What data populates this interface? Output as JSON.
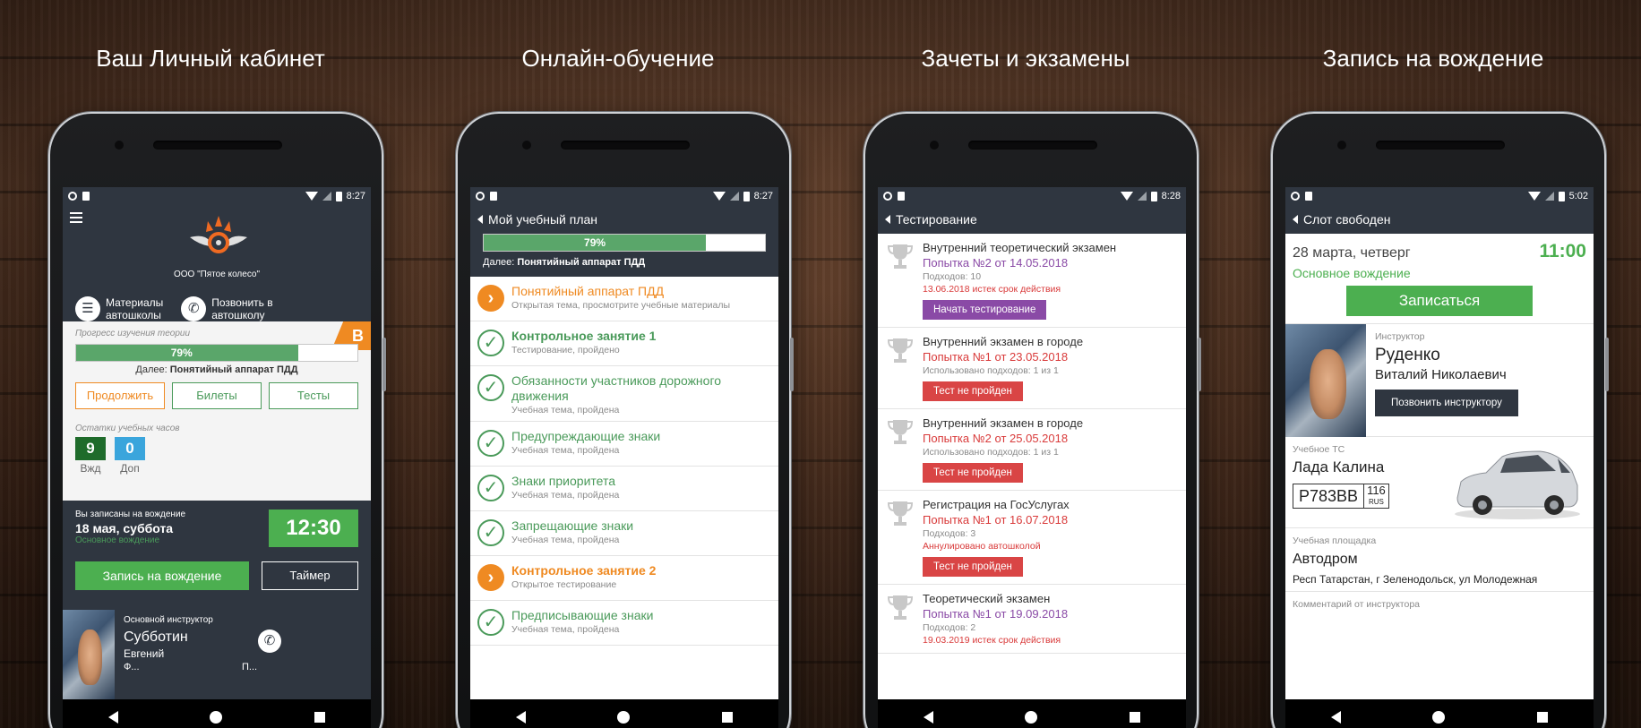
{
  "panels": [
    {
      "title": "Ваш Личный кабинет",
      "status_time": "8:27",
      "org_name": "ООО \"Пятое колесо\"",
      "actions": [
        {
          "label_line1": "Материалы",
          "label_line2": "автошколы",
          "icon": "book-icon"
        },
        {
          "label_line1": "Позвонить в",
          "label_line2": "автошколу",
          "icon": "phone-icon"
        }
      ],
      "category_badge": "B",
      "progress_label": "Прогресс изучения теории",
      "progress_percent": 79,
      "progress_text": "79%",
      "next_prefix": "Далее:",
      "next_topic": "Понятийный аппарат ПДД",
      "buttons": [
        "Продолжить",
        "Билеты",
        "Тесты"
      ],
      "hours_label": "Остатки учебных часов",
      "hours": [
        {
          "value": "9",
          "label": "Вжд",
          "color": "#1f6b2b"
        },
        {
          "value": "0",
          "label": "Доп",
          "color": "#3aa5dc"
        }
      ],
      "drive": {
        "status": "Вы записаны на вождение",
        "date": "18 мая, суббота",
        "type": "Основное вождение",
        "time": "12:30",
        "book_button": "Запись на вождение",
        "timer_button": "Таймер"
      },
      "instructor": {
        "role": "Основной инструктор",
        "surname": "Субботин",
        "name": "Евгений",
        "cut_left": "Ф...",
        "cut_right": "П..."
      }
    },
    {
      "title": "Онлайн-обучение",
      "status_time": "8:27",
      "header": "Мой учебный план",
      "progress_percent": 79,
      "progress_text": "79%",
      "next_prefix": "Далее:",
      "next_topic": "Понятийный аппарат ПДД",
      "items": [
        {
          "title": "Понятийный аппарат ПДД",
          "sub": "Открытая тема, просмотрите учебные материалы",
          "state": "open"
        },
        {
          "title": "Контрольное занятие 1",
          "sub": "Тестирование, пройдено",
          "state": "done-bold"
        },
        {
          "title": "Обязанности участников дорожного движения",
          "sub": "Учебная тема, пройдена",
          "state": "done"
        },
        {
          "title": "Предупреждающие знаки",
          "sub": "Учебная тема, пройдена",
          "state": "done"
        },
        {
          "title": "Знаки приоритета",
          "sub": "Учебная тема, пройдена",
          "state": "done"
        },
        {
          "title": "Запрещающие знаки",
          "sub": "Учебная тема, пройдена",
          "state": "done"
        },
        {
          "title": "Контрольное занятие 2",
          "sub": "Открытое тестирование",
          "state": "open-bold"
        },
        {
          "title": "Предписывающие знаки",
          "sub": "Учебная тема, пройдена",
          "state": "done"
        }
      ]
    },
    {
      "title": "Зачеты и экзамены",
      "status_time": "8:28",
      "header": "Тестирование",
      "tests": [
        {
          "name": "Внутренний теоретический экзамен",
          "attempt": "Попытка №2  от 14.05.2018",
          "attempt_color": "#8a4aa6",
          "stat": "Подходов: 10",
          "warn": "13.06.2018 истек срок действия",
          "button": "Начать тестирование",
          "button_color": "#8a4aa6"
        },
        {
          "name": "Внутренний экзамен в городе",
          "attempt": "Попытка №1  от 23.05.2018",
          "attempt_color": "#d93a3a",
          "stat": "Использовано подходов: 1 из 1",
          "warn": "",
          "button": "Тест не пройден",
          "button_color": "#d94545"
        },
        {
          "name": "Внутренний экзамен в городе",
          "attempt": "Попытка №2  от 25.05.2018",
          "attempt_color": "#d93a3a",
          "stat": "Использовано подходов: 1 из 1",
          "warn": "",
          "button": "Тест не пройден",
          "button_color": "#d94545"
        },
        {
          "name": "Регистрация на ГосУслугах",
          "attempt": "Попытка №1  от 16.07.2018",
          "attempt_color": "#d93a3a",
          "stat": "Подходов: 3",
          "warn": "Аннулировано автошколой",
          "button": "Тест не пройден",
          "button_color": "#d94545"
        },
        {
          "name": "Теоретический экзамен",
          "attempt": "Попытка №1  от 19.09.2018",
          "attempt_color": "#8a4aa6",
          "stat": "Подходов: 2",
          "warn": "19.03.2019 истек срок действия",
          "button": "",
          "button_color": "#8a4aa6"
        }
      ]
    },
    {
      "title": "Запись на вождение",
      "status_time": "5:02",
      "header": "Слот свободен",
      "date": "28 марта, четверг",
      "time": "11:00",
      "type": "Основное вождение",
      "book_button": "Записаться",
      "instructor_label": "Инструктор",
      "instructor_surname": "Руденко",
      "instructor_name": "Виталий Николаевич",
      "call_button": "Позвонить инструктору",
      "vehicle_label": "Учебное ТС",
      "vehicle_name": "Лада Калина",
      "plate_main": "Р783ВВ",
      "plate_region": "116",
      "plate_country": "RUS",
      "site_label": "Учебная площадка",
      "site_name": "Автодром",
      "site_address": "Респ Татарстан, г Зеленодольск, ул Молодежная",
      "comment_label": "Комментарий от инструктора"
    }
  ]
}
